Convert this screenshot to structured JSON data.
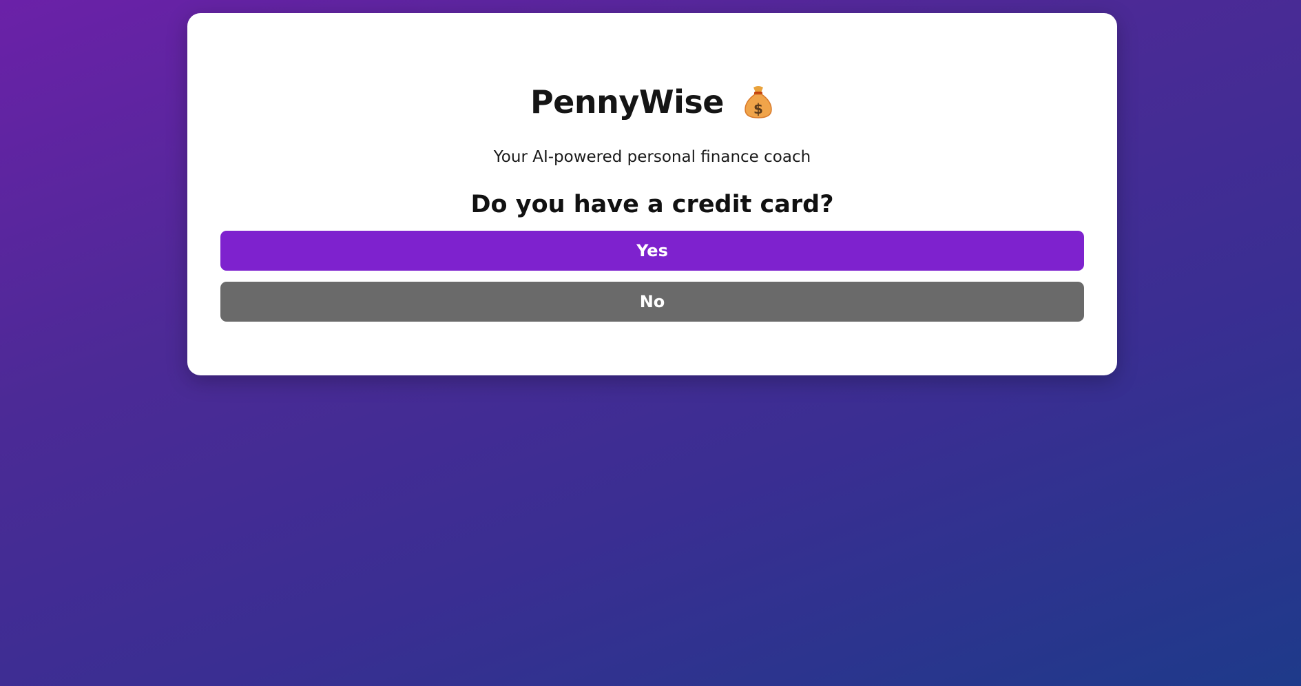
{
  "app": {
    "title": "PennyWise",
    "icon": "money-bag-icon",
    "subtitle": "Your AI-powered personal finance coach"
  },
  "question": {
    "text": "Do you have a credit card?",
    "options": [
      {
        "label": "Yes",
        "color": "#7e22ce"
      },
      {
        "label": "No",
        "color": "#6a6a6a"
      }
    ]
  }
}
